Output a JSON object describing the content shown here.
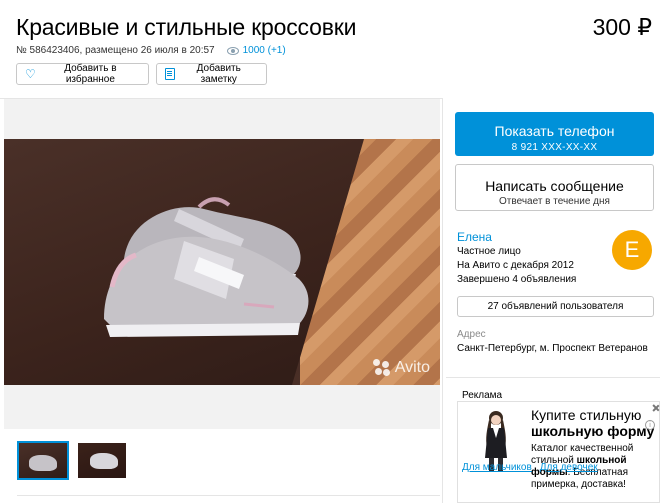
{
  "listing": {
    "title": "Красивые и стильные кроссовки",
    "price": "300 ₽",
    "meta_text": "№ 586423406, размещено 26 июля в 20:57",
    "views": "1000 (+1)"
  },
  "actions": {
    "favorite_label": "Добавить в избранное",
    "note_label": "Добавить заметку"
  },
  "gallery": {
    "watermark": "Avito",
    "thumbnail_count": 2
  },
  "contact": {
    "phone_button_label": "Показать телефон",
    "phone_masked": "8 921 XXX-XX-XX",
    "message_button_label": "Написать сообщение",
    "message_button_sub": "Отвечает в течение дня"
  },
  "seller": {
    "name": "Елена",
    "type": "Частное лицо",
    "since": "На Авито с декабря 2012",
    "completed": "Завершено 4 объявления",
    "avatar_letter": "E",
    "avatar_color": "#f7a800",
    "ads_button_label": "27 объявлений пользователя"
  },
  "address": {
    "label": "Адрес",
    "value": "Санкт-Петербург, м. Проспект Ветеранов"
  },
  "advertisement": {
    "label": "Реклама",
    "headline_plain": "Купите стильную",
    "headline_bold": "школьную форму",
    "text_1": "Каталог качественной стильной",
    "text_bold_1": "школьной",
    "text_bold_2": "формы",
    "text_2": ". Бесплатная примерка, доставка!",
    "link_1": "Для мальчиков",
    "link_2": "Для девочек"
  },
  "colors": {
    "accent": "#0091d9"
  }
}
